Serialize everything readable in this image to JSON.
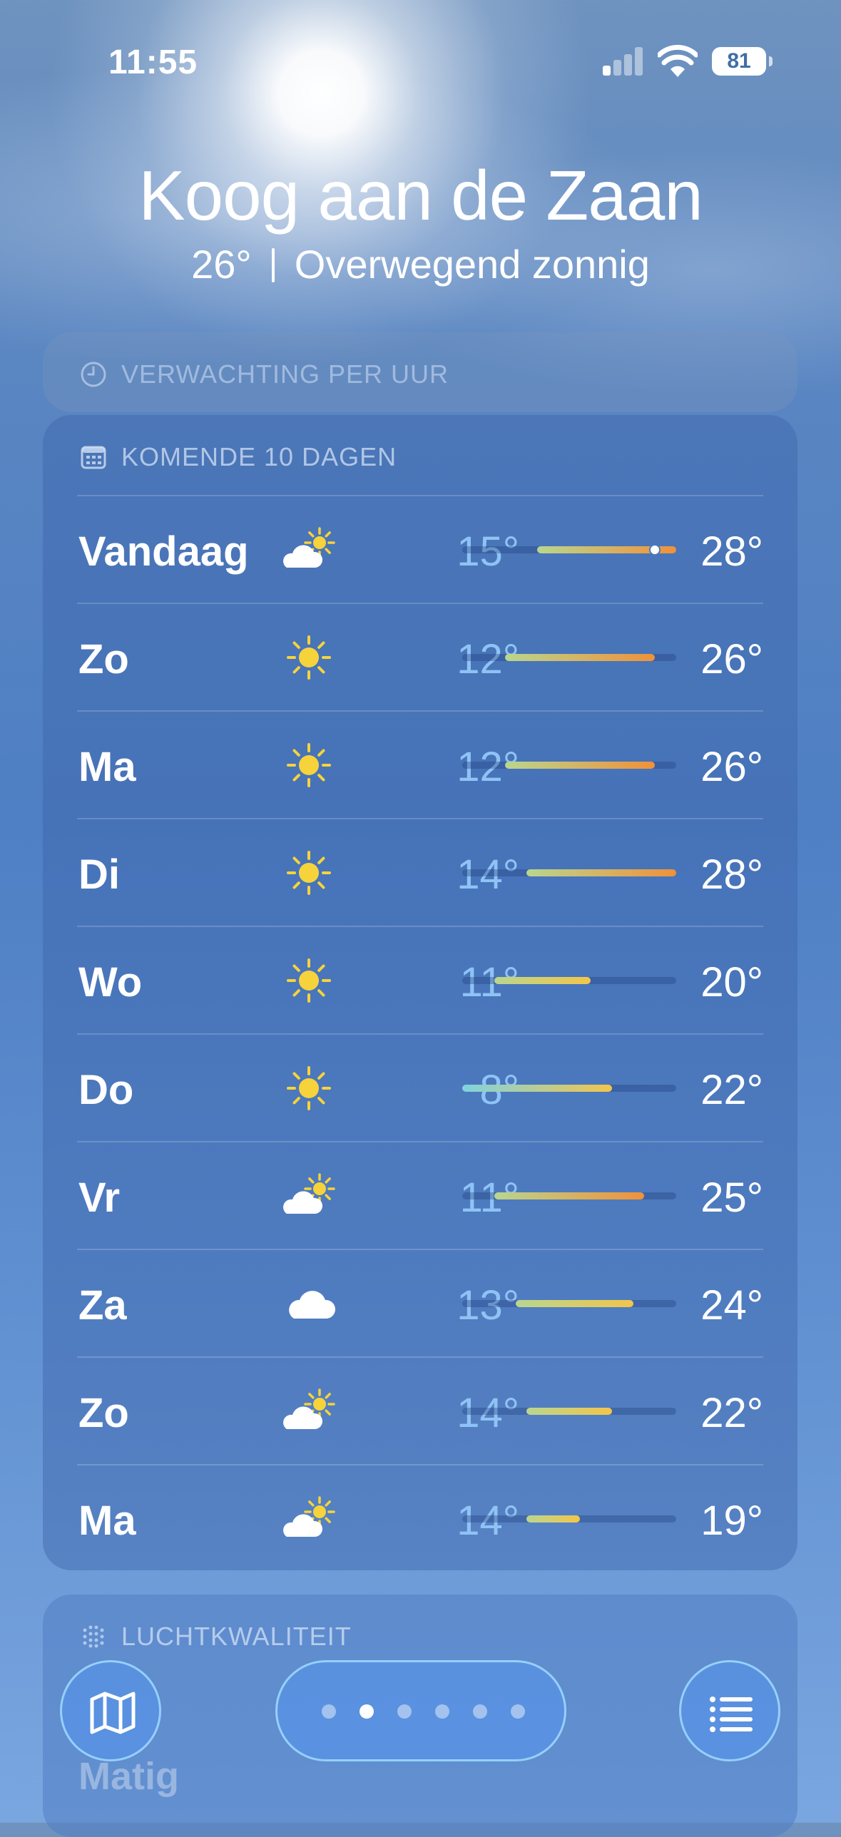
{
  "status": {
    "time": "11:55",
    "battery": "81"
  },
  "location": {
    "city": "Koog aan de Zaan",
    "temp": "26°",
    "condition": "Overwegend zonnig"
  },
  "hourly": {
    "label": "VERWACHTING PER UUR"
  },
  "forecast": {
    "label": "KOMENDE 10 DAGEN",
    "range": [
      8,
      28
    ],
    "days": [
      {
        "day": "Vandaag",
        "icon": "partly-sunny-icon",
        "low": "15°",
        "high": "28°",
        "lo": 15,
        "hi": 28,
        "current": 26
      },
      {
        "day": "Zo",
        "icon": "sun-icon",
        "low": "12°",
        "high": "26°",
        "lo": 12,
        "hi": 26
      },
      {
        "day": "Ma",
        "icon": "sun-icon",
        "low": "12°",
        "high": "26°",
        "lo": 12,
        "hi": 26
      },
      {
        "day": "Di",
        "icon": "sun-icon",
        "low": "14°",
        "high": "28°",
        "lo": 14,
        "hi": 28
      },
      {
        "day": "Wo",
        "icon": "sun-icon",
        "low": "11°",
        "high": "20°",
        "lo": 11,
        "hi": 20
      },
      {
        "day": "Do",
        "icon": "sun-icon",
        "low": "8°",
        "high": "22°",
        "lo": 8,
        "hi": 22
      },
      {
        "day": "Vr",
        "icon": "partly-sunny-icon",
        "low": "11°",
        "high": "25°",
        "lo": 11,
        "hi": 25
      },
      {
        "day": "Za",
        "icon": "cloud-icon",
        "low": "13°",
        "high": "24°",
        "lo": 13,
        "hi": 24
      },
      {
        "day": "Zo",
        "icon": "partly-sunny-icon",
        "low": "14°",
        "high": "22°",
        "lo": 14,
        "hi": 22
      },
      {
        "day": "Ma",
        "icon": "partly-sunny-icon",
        "low": "14°",
        "high": "19°",
        "lo": 14,
        "hi": 19
      }
    ]
  },
  "air": {
    "label": "LUCHTKWALITEIT",
    "value": "Matig"
  },
  "pager": {
    "count": 6,
    "active": 1
  },
  "colors": {
    "sun": "#f6d33b",
    "cool": "#7fd3df",
    "mild": "#b9d68f",
    "warm": "#f3c54a",
    "hot": "#f0913a"
  }
}
